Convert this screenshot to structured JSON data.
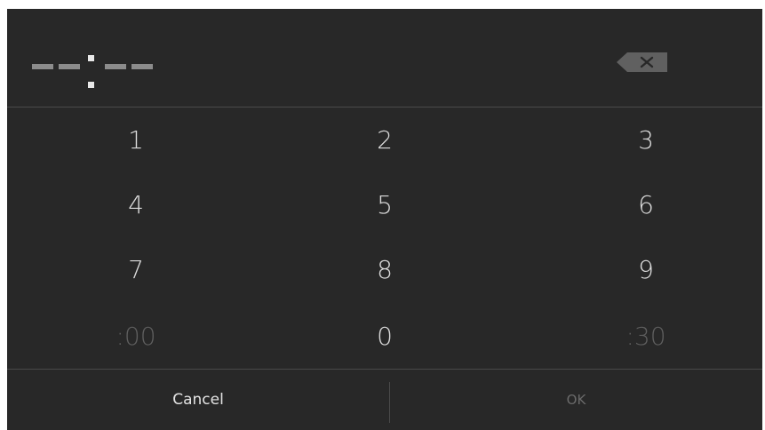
{
  "display": {
    "placeholder": "--:--",
    "backspace_icon": "backspace-icon"
  },
  "keypad": {
    "keys": [
      {
        "label": "1",
        "enabled": true
      },
      {
        "label": "2",
        "enabled": true
      },
      {
        "label": "3",
        "enabled": true
      },
      {
        "label": "4",
        "enabled": true
      },
      {
        "label": "5",
        "enabled": true
      },
      {
        "label": "6",
        "enabled": true
      },
      {
        "label": "7",
        "enabled": true
      },
      {
        "label": "8",
        "enabled": true
      },
      {
        "label": "9",
        "enabled": true
      },
      {
        "label": ":00",
        "enabled": false
      },
      {
        "label": "0",
        "enabled": true
      },
      {
        "label": ":30",
        "enabled": false
      }
    ]
  },
  "buttons": {
    "cancel_label": "Cancel",
    "ok_label": "OK",
    "ok_enabled": false
  },
  "colors": {
    "background": "#282828",
    "text": "#dcdcdc",
    "disabled_text": "#5e5e5e",
    "divider": "#4a4a4a"
  }
}
